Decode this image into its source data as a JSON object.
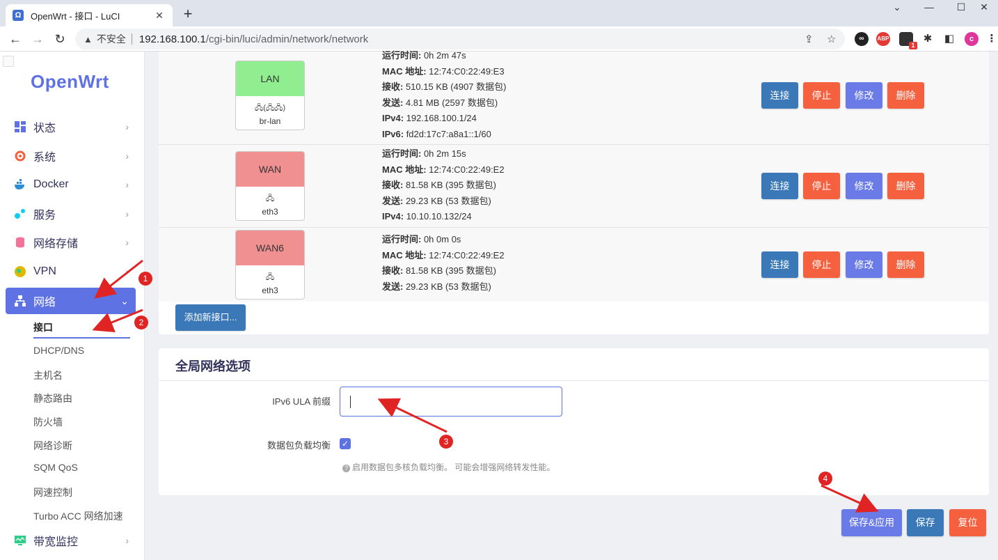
{
  "browser": {
    "tab_title": "OpenWrt - 接口 - LuCI",
    "tab_favicon": "Ω",
    "new_tab": "+",
    "close": "✕",
    "insecure_label": "不安全",
    "url_host": "192.168.100.1",
    "url_path": "/cgi-bin/luci/admin/network/network",
    "ext_badge_count": "1",
    "profile_initial": "c",
    "icons": [
      "back-icon",
      "forward-icon",
      "reload-icon",
      "share-icon",
      "star-icon",
      "puzzle-icon",
      "sidebar-icon"
    ]
  },
  "sidebar": {
    "logo": "OpenWrt",
    "menu": [
      {
        "label": "状态",
        "icon": "dashboard-icon"
      },
      {
        "label": "系统",
        "icon": "gear-icon"
      },
      {
        "label": "Docker",
        "icon": "docker-icon"
      },
      {
        "label": "服务",
        "icon": "services-icon"
      },
      {
        "label": "网络存储",
        "icon": "database-icon"
      },
      {
        "label": "VPN",
        "icon": "globe-icon"
      },
      {
        "label": "网络",
        "icon": "network-icon"
      },
      {
        "label": "带宽监控",
        "icon": "monitor-icon"
      }
    ],
    "submenu": [
      "接口",
      "DHCP/DNS",
      "主机名",
      "静态路由",
      "防火墙",
      "网络诊断",
      "SQM QoS",
      "网速控制",
      "Turbo ACC 网络加速"
    ]
  },
  "interfaces": [
    {
      "name": "LAN",
      "device": "br-lan",
      "device_glyph": "🖧(🖧🖧)",
      "stats": [
        {
          "k": "运行时间:",
          "v": " 0h 2m 47s"
        },
        {
          "k": "MAC 地址:",
          "v": " 12:74:C0:22:49:E3"
        },
        {
          "k": "接收:",
          "v": " 510.15 KB (4907 数据包)"
        },
        {
          "k": "发送:",
          "v": " 4.81 MB (2597 数据包)"
        },
        {
          "k": "IPv4:",
          "v": " 192.168.100.1/24"
        },
        {
          "k": "IPv6:",
          "v": " fd2d:17c7:a8a1::1/60"
        }
      ]
    },
    {
      "name": "WAN",
      "device": "eth3",
      "device_glyph": "🖧",
      "stats": [
        {
          "k": "运行时间:",
          "v": " 0h 2m 15s"
        },
        {
          "k": "MAC 地址:",
          "v": " 12:74:C0:22:49:E2"
        },
        {
          "k": "接收:",
          "v": " 81.58 KB (395 数据包)"
        },
        {
          "k": "发送:",
          "v": " 29.23 KB (53 数据包)"
        },
        {
          "k": "IPv4:",
          "v": " 10.10.10.132/24"
        }
      ]
    },
    {
      "name": "WAN6",
      "device": "eth3",
      "device_glyph": "🖧",
      "stats": [
        {
          "k": "运行时间:",
          "v": " 0h 0m 0s"
        },
        {
          "k": "MAC 地址:",
          "v": " 12:74:C0:22:49:E2"
        },
        {
          "k": "接收:",
          "v": " 81.58 KB (395 数据包)"
        },
        {
          "k": "发送:",
          "v": " 29.23 KB (53 数据包)"
        }
      ]
    }
  ],
  "row_buttons": {
    "connect": "连接",
    "stop": "停止",
    "edit": "修改",
    "delete": "删除"
  },
  "add_interface": "添加新接口...",
  "global": {
    "title": "全局网络选项",
    "ula_label": "IPv6 ULA 前缀",
    "ula_value": "",
    "balance_label": "数据包负载均衡",
    "balance_checked": true,
    "balance_hint": "启用数据包多核负载均衡。 可能会增强网络转发性能。"
  },
  "footer": {
    "save_apply": "保存&应用",
    "save": "保存",
    "reset": "复位"
  },
  "annotations": [
    "1",
    "2",
    "3",
    "4"
  ],
  "colors": {
    "accent": "#5e72e4",
    "lan": "#90ee90",
    "wan": "#f09090",
    "annotation": "#e02424"
  }
}
